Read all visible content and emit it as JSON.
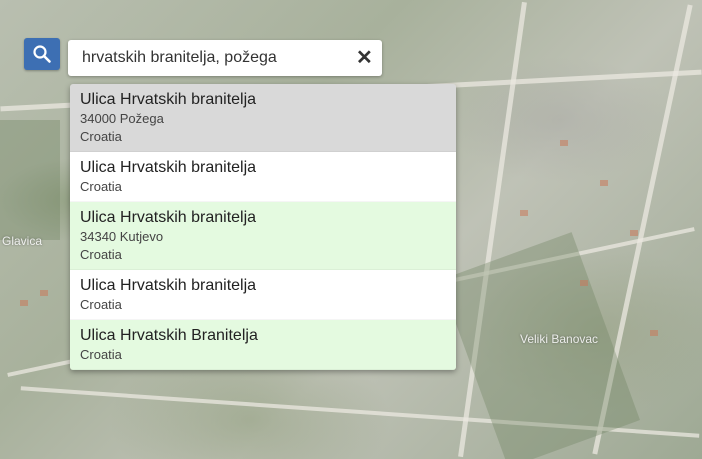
{
  "search": {
    "query": "hrvatskih branitelja, požega",
    "clear_label": "✕",
    "icon": "search-icon"
  },
  "map": {
    "labels": [
      "Glavica",
      "Veliki Banovac"
    ]
  },
  "results": [
    {
      "title": "Ulica Hrvatskih branitelja",
      "lines": [
        "34000 Požega",
        "Croatia"
      ],
      "style": "selected"
    },
    {
      "title": "Ulica Hrvatskih branitelja",
      "lines": [
        "Croatia"
      ],
      "style": "white"
    },
    {
      "title": "Ulica Hrvatskih branitelja",
      "lines": [
        "34340 Kutjevo",
        "Croatia"
      ],
      "style": "green"
    },
    {
      "title": "Ulica Hrvatskih branitelja",
      "lines": [
        "Croatia"
      ],
      "style": "white"
    },
    {
      "title": "Ulica Hrvatskih Branitelja",
      "lines": [
        "Croatia"
      ],
      "style": "green"
    }
  ],
  "colors": {
    "search_button": "#3d6fb3",
    "selected_row": "#d9d9d9",
    "highlight_row": "#e4fae0"
  }
}
